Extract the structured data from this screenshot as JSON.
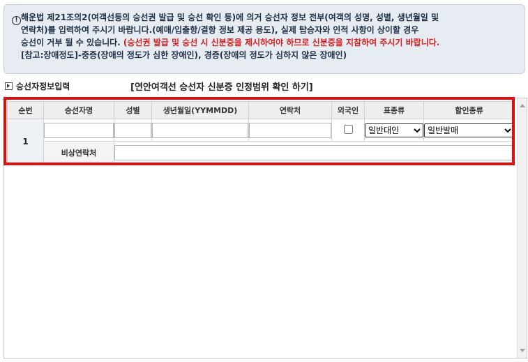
{
  "notice": {
    "line1": "해운법 제21조의2(여객선등의 승선권 발급 및 승선 확인 등)에 의거 승선자 정보 전부(여객의 성명, 성별, 생년월일 및",
    "line2": "연락처)를 입력하여 주시기 바랍니다.(예매/입출항/결항 정보 제공 용도), 실제 탑승자와 인적 사항이 상이할 경우",
    "line3_black": "승선이 거부 될 수 있습니다.",
    "line3_red": "(승선권 발급 및 승선 시 신분증을 제시하여야 하므로 신분증을 지참하여 주시기 바랍니다.",
    "line4": "[참고:장애정도]-중증(장애의 정도가 심한 장애인), 경증(장애의 정도가 심하지 않은 장애인)"
  },
  "section": {
    "title": "승선자정보입력",
    "verify_link": "[연안여객선 승선자 신분증 인정범위 확인 하기]"
  },
  "table": {
    "headers": [
      "순번",
      "승선자명",
      "성별",
      "생년월일(YYMMDD)",
      "연락처",
      "외국인",
      "표종류",
      "할인종류"
    ],
    "row": {
      "number": "1",
      "name": "",
      "gender": "",
      "birthdate": "",
      "phone": "",
      "foreigner_checked": false,
      "ticket_type": "일반대인",
      "discount_type": "일반발매",
      "emergency_label": "비상연락처",
      "emergency_contact": ""
    }
  },
  "colors": {
    "highlight": "#e01010",
    "notice_bg": "#e7ecf2",
    "warning_text": "#d42020"
  },
  "icons": {
    "notice": "exclamation-circle-icon"
  }
}
